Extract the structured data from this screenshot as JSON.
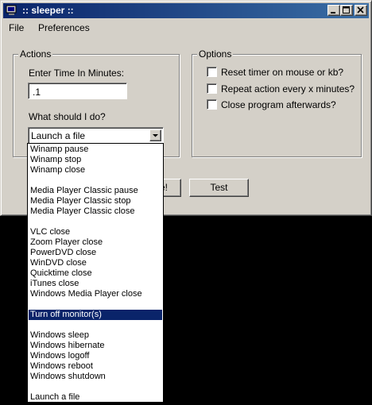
{
  "window": {
    "title": ":: sleeper ::"
  },
  "menu": {
    "file": "File",
    "preferences": "Preferences"
  },
  "actions": {
    "group_title": "Actions",
    "time_label": "Enter Time In Minutes:",
    "time_value": ".1",
    "what_label": "What should I do?",
    "selected": "Launch a file"
  },
  "options": {
    "group_title": "Options",
    "items": [
      {
        "label": "Reset timer on mouse or kb?",
        "checked": false
      },
      {
        "label": "Repeat action every x minutes?",
        "checked": false
      },
      {
        "label": "Close program afterwards?",
        "checked": false
      }
    ]
  },
  "buttons": {
    "go_partial": "e!",
    "test": "Test"
  },
  "dropdown": {
    "highlighted_index": 16,
    "items": [
      "Winamp pause",
      "Winamp stop",
      "Winamp close",
      "",
      "Media Player Classic pause",
      "Media Player Classic stop",
      "Media Player Classic close",
      "",
      "VLC close",
      "Zoom Player close",
      "PowerDVD close",
      "WinDVD close",
      "Quicktime close",
      "iTunes close",
      "Windows Media Player close",
      "",
      "Turn off monitor(s)",
      "",
      "Windows sleep",
      "Windows hibernate",
      "Windows logoff",
      "Windows reboot",
      "Windows shutdown",
      "",
      "Launch a file"
    ]
  }
}
